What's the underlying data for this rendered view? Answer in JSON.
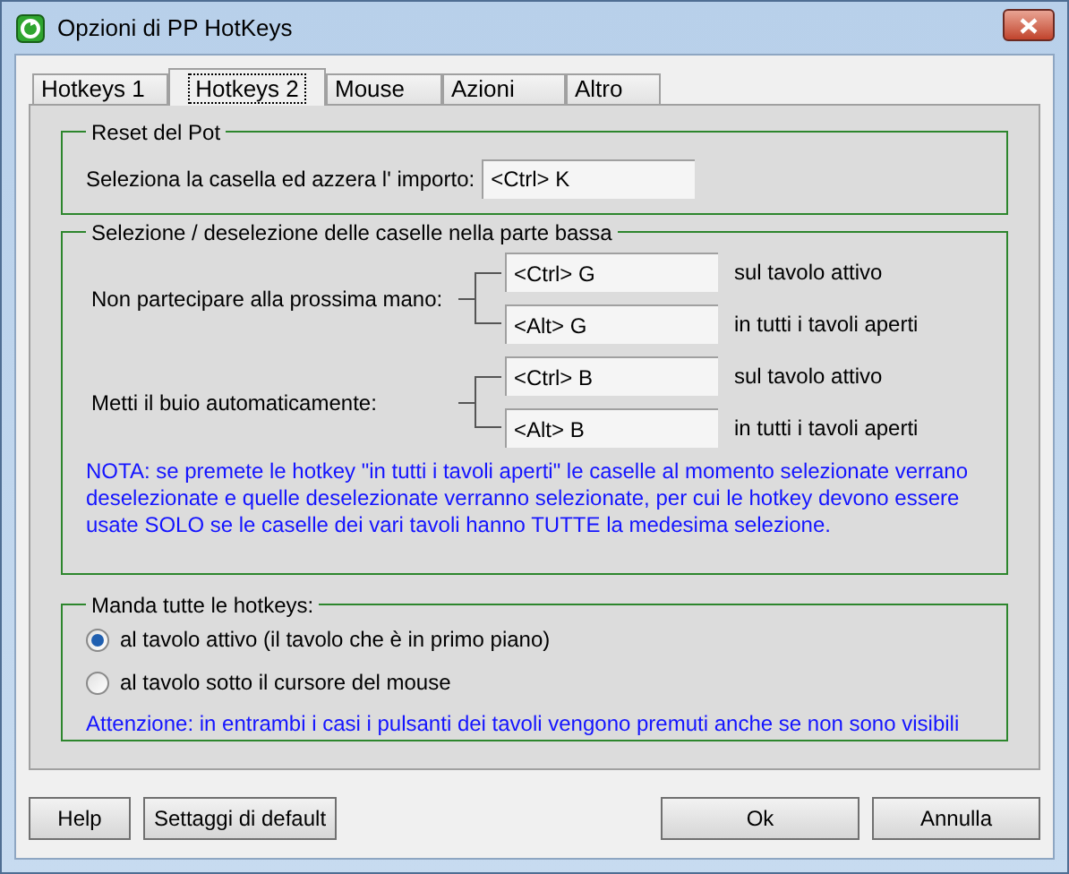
{
  "window": {
    "title": "Opzioni di PP HotKeys"
  },
  "tabs": [
    {
      "label": "Hotkeys 1",
      "selected": false
    },
    {
      "label": "Hotkeys 2",
      "selected": true
    },
    {
      "label": "Mouse",
      "selected": false
    },
    {
      "label": "Azioni",
      "selected": false
    },
    {
      "label": "Altro",
      "selected": false
    }
  ],
  "reset_group": {
    "title": "Reset del Pot",
    "label": "Seleziona la casella ed azzera l' importo:",
    "value": "<Ctrl> K"
  },
  "selection_group": {
    "title": "Selezione / deselezione delle caselle nella parte bassa",
    "hotkeys": [
      {
        "label": "Non partecipare alla prossima mano:",
        "fields": [
          {
            "value": "<Ctrl> G",
            "scope": "sul tavolo attivo"
          },
          {
            "value": "<Alt> G",
            "scope": "in tutti i tavoli aperti"
          }
        ]
      },
      {
        "label": "Metti il buio automaticamente:",
        "fields": [
          {
            "value": "<Ctrl> B",
            "scope": "sul tavolo attivo"
          },
          {
            "value": "<Alt> B",
            "scope": "in tutti i tavoli aperti"
          }
        ]
      }
    ],
    "note": "NOTA: se premete le hotkey \"in tutti i tavoli aperti\" le caselle al momento selezionate verrano deselezionate e quelle deselezionate verranno selezionate, per cui le hotkey devono essere usate SOLO se le caselle dei vari tavoli hanno TUTTE la medesima selezione."
  },
  "send_group": {
    "title": "Manda tutte le hotkeys:",
    "options": [
      {
        "label": "al tavolo attivo (il tavolo che è in primo piano)",
        "selected": true
      },
      {
        "label": "al tavolo sotto il cursore del mouse",
        "selected": false
      }
    ],
    "warning": "Attenzione: in entrambi i casi i pulsanti dei tavoli vengono premuti anche se non sono visibili"
  },
  "buttons": [
    {
      "label": "Help",
      "kind": "left"
    },
    {
      "label": "Settaggi di default",
      "kind": "left"
    },
    {
      "label": "Ok",
      "kind": "right"
    },
    {
      "label": "Annulla",
      "kind": "right"
    }
  ]
}
